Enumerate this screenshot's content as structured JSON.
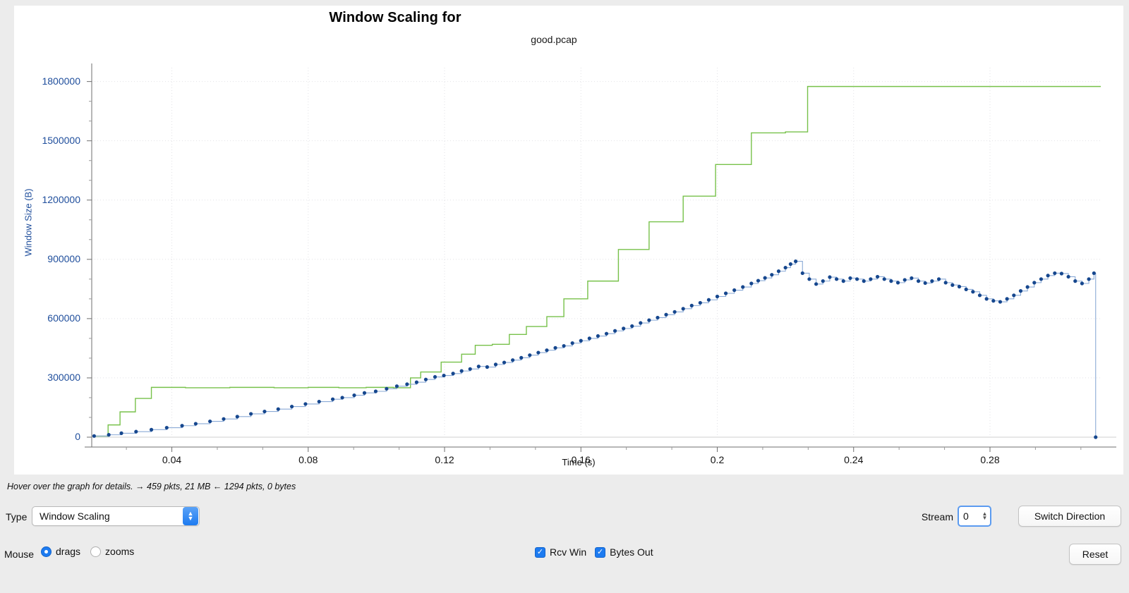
{
  "header": {
    "title": "Window Scaling for",
    "subtitle": "good.pcap"
  },
  "hint": {
    "text": "Hover over the graph for details. → 459 pkts, 21 MB ← 1294 pkts, 0 bytes"
  },
  "controls": {
    "type_label": "Type",
    "type_value": "Window Scaling",
    "stream_label": "Stream",
    "stream_value": "0",
    "switch_direction_label": "Switch Direction",
    "reset_label": "Reset",
    "mouse_label": "Mouse",
    "mouse_drags_label": "drags",
    "mouse_zooms_label": "zooms",
    "mouse_selected": "drags",
    "rcv_win_label": "Rcv Win",
    "bytes_out_label": "Bytes Out",
    "rcv_win_checked": true,
    "bytes_out_checked": true,
    "check_glyph": "✓"
  },
  "colors": {
    "rcv_win": "#77c14a",
    "bytes_out_point": "#16478e",
    "bytes_out_line": "#8aaad6",
    "axis_text_y": "#1f4e9c",
    "axis_text_x": "#111111",
    "grid": "#e2e2e6",
    "axis_line": "#6f6f6f",
    "accent_blue": "#1d7bf0",
    "card_bg": "#ffffff",
    "page_bg": "#ececec"
  },
  "chart_data": {
    "type": "line",
    "title": "Window Scaling for",
    "subtitle": "good.pcap",
    "xlabel": "Time (s)",
    "ylabel": "Window Size (B)",
    "xlim": [
      0.0165,
      0.3125
    ],
    "ylim": [
      0,
      1870000
    ],
    "xticks": [
      0.04,
      0.08,
      0.12,
      0.16,
      0.2,
      0.24,
      0.28
    ],
    "yticks": [
      0,
      300000,
      600000,
      900000,
      1200000,
      1500000,
      1800000
    ],
    "xtick_labels": [
      "0.04",
      "0.08",
      "0.12",
      "0.16",
      "0.2",
      "0.24",
      "0.28"
    ],
    "ytick_labels": [
      "0",
      "300000",
      "600000",
      "900000",
      "1200000",
      "1500000",
      "1800000"
    ],
    "minor_ticks_per_major": 2,
    "grid": true,
    "legend": "none",
    "series": [
      {
        "name": "Rcv Win",
        "color": "#77c14a",
        "style": "step",
        "markers": false,
        "x": [
          0.017,
          0.0205,
          0.0213,
          0.024,
          0.0248,
          0.0285,
          0.0293,
          0.033,
          0.034,
          0.043,
          0.044,
          0.056,
          0.057,
          0.069,
          0.07,
          0.079,
          0.08,
          0.088,
          0.089,
          0.096,
          0.097,
          0.104,
          0.105,
          0.109,
          0.11,
          0.112,
          0.113,
          0.118,
          0.119,
          0.124,
          0.125,
          0.128,
          0.129,
          0.133,
          0.134,
          0.138,
          0.139,
          0.143,
          0.144,
          0.149,
          0.15,
          0.154,
          0.155,
          0.161,
          0.162,
          0.17,
          0.171,
          0.179,
          0.18,
          0.189,
          0.19,
          0.1985,
          0.1995,
          0.209,
          0.21,
          0.219,
          0.22,
          0.2255,
          0.2265,
          0.3125
        ],
        "y": [
          5000,
          5000,
          62000,
          62000,
          128000,
          128000,
          196000,
          196000,
          252000,
          252000,
          250000,
          250000,
          252000,
          252000,
          250000,
          250000,
          252000,
          252000,
          250000,
          250000,
          252000,
          252000,
          250000,
          250000,
          300000,
          300000,
          330000,
          330000,
          380000,
          380000,
          420000,
          420000,
          465000,
          465000,
          470000,
          470000,
          520000,
          520000,
          560000,
          560000,
          610000,
          610000,
          700000,
          700000,
          790000,
          790000,
          950000,
          950000,
          1090000,
          1090000,
          1220000,
          1220000,
          1380000,
          1380000,
          1540000,
          1540000,
          1545000,
          1545000,
          1775000,
          1775000
        ]
      },
      {
        "name": "Bytes Out",
        "color": "#16478e",
        "line_color": "#8aaad6",
        "style": "step-markers",
        "markers": true,
        "x": [
          0.0172,
          0.0215,
          0.0252,
          0.0295,
          0.034,
          0.0385,
          0.043,
          0.047,
          0.0512,
          0.0552,
          0.0592,
          0.0632,
          0.0672,
          0.0712,
          0.0752,
          0.0792,
          0.0832,
          0.0872,
          0.09,
          0.0935,
          0.0965,
          0.0998,
          0.103,
          0.106,
          0.109,
          0.1118,
          0.1145,
          0.1172,
          0.1198,
          0.1225,
          0.125,
          0.1275,
          0.13,
          0.1325,
          0.135,
          0.1375,
          0.14,
          0.1425,
          0.145,
          0.1475,
          0.15,
          0.1525,
          0.155,
          0.1575,
          0.16,
          0.1625,
          0.165,
          0.1675,
          0.17,
          0.1725,
          0.175,
          0.1775,
          0.18,
          0.1825,
          0.185,
          0.1875,
          0.19,
          0.1925,
          0.195,
          0.1975,
          0.2,
          0.2025,
          0.205,
          0.2075,
          0.21,
          0.212,
          0.214,
          0.216,
          0.218,
          0.22,
          0.2215,
          0.223,
          0.225,
          0.227,
          0.229,
          0.231,
          0.233,
          0.235,
          0.237,
          0.239,
          0.241,
          0.243,
          0.245,
          0.247,
          0.249,
          0.251,
          0.253,
          0.255,
          0.257,
          0.259,
          0.261,
          0.263,
          0.265,
          0.267,
          0.269,
          0.271,
          0.273,
          0.275,
          0.277,
          0.279,
          0.281,
          0.283,
          0.285,
          0.287,
          0.289,
          0.291,
          0.293,
          0.295,
          0.297,
          0.299,
          0.301,
          0.303,
          0.305,
          0.307,
          0.309,
          0.3105,
          0.311
        ],
        "y": [
          6000,
          12000,
          20000,
          28000,
          38000,
          48000,
          58000,
          68000,
          80000,
          92000,
          104000,
          118000,
          130000,
          142000,
          155000,
          168000,
          180000,
          192000,
          200000,
          212000,
          224000,
          232000,
          245000,
          258000,
          268000,
          278000,
          292000,
          305000,
          312000,
          322000,
          335000,
          345000,
          358000,
          355000,
          368000,
          378000,
          390000,
          402000,
          415000,
          428000,
          440000,
          452000,
          462000,
          476000,
          488000,
          500000,
          512000,
          524000,
          538000,
          550000,
          562000,
          578000,
          592000,
          605000,
          620000,
          634000,
          650000,
          666000,
          680000,
          695000,
          712000,
          728000,
          744000,
          760000,
          778000,
          792000,
          806000,
          822000,
          840000,
          858000,
          876000,
          890000,
          830000,
          800000,
          775000,
          790000,
          810000,
          800000,
          790000,
          805000,
          800000,
          790000,
          800000,
          812000,
          800000,
          790000,
          782000,
          796000,
          805000,
          790000,
          780000,
          790000,
          800000,
          782000,
          770000,
          762000,
          748000,
          736000,
          718000,
          700000,
          690000,
          685000,
          700000,
          718000,
          740000,
          760000,
          782000,
          800000,
          818000,
          830000,
          828000,
          812000,
          790000,
          778000,
          800000,
          830000,
          0
        ]
      }
    ]
  }
}
